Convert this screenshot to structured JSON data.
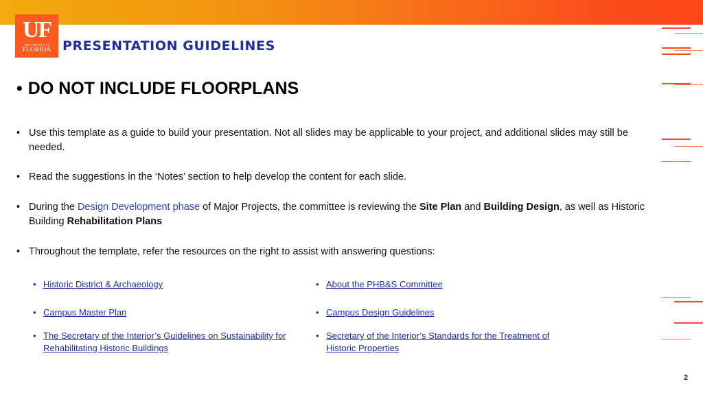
{
  "header": {
    "logo": {
      "main": "UF",
      "line1": "UNIVERSITY of",
      "line2": "FLORIDA"
    },
    "title": "PRESENTATION GUIDELINES"
  },
  "main": {
    "heading": {
      "bullet": "•",
      "text": "DO NOT INCLUDE FLOORPLANS"
    },
    "bullets": [
      {
        "text": "Use this template as a guide to build your presentation. Not all slides may be applicable to your project, and additional slides may still be needed."
      },
      {
        "text": "Read the suggestions in the ‘Notes’ section to help develop the content for each slide."
      },
      {
        "part1": "During the ",
        "link": "Design Development phase",
        "part2": " of Major Projects, the committee is reviewing the ",
        "bold1": "Site Plan",
        "part3": " and ",
        "bold2": "Building Design",
        "part4": ", as well as Historic Building ",
        "bold3": "Rehabilitation Plans"
      },
      {
        "text": "Throughout the template, refer the resources on the right to assist with answering questions:"
      }
    ],
    "bullet_char": "•",
    "resources": {
      "left": [
        "Historic District & Archaeology",
        "Campus Master Plan",
        "The Secretary of the Interior’s Guidelines on Sustainability for Rehabilitating Historic Buildings"
      ],
      "right": [
        "About the PHB&S Committee",
        "Campus Design Guidelines",
        "Secretary of the Interior’s Standards for the Treatment of Historic Properties"
      ]
    }
  },
  "footer": {
    "page_number": "2"
  },
  "colors": {
    "brand_orange": "#fa5a1e",
    "title_blue": "#1e2f9a",
    "link_blue": "#1c2f9b"
  }
}
